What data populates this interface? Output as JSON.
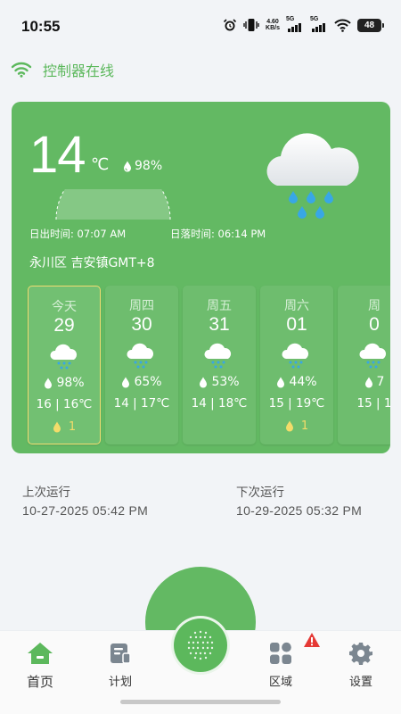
{
  "status_bar": {
    "time": "10:55",
    "net_speed": "4.60",
    "net_unit": "KB/s",
    "net_5g_1": "5G",
    "net_5g_2": "5G",
    "battery": "48"
  },
  "controller": {
    "status_text": "控制器在线",
    "color": "#5cb85c"
  },
  "weather": {
    "temperature": "14",
    "unit": "℃",
    "humidity": "98%",
    "sunrise_label": "日出时间:",
    "sunrise_time": "07:07 AM",
    "sunset_label": "日落时间:",
    "sunset_time": "06:14 PM",
    "location": "永川区 吉安镇GMT+8",
    "current_icon": "rain-cloud-icon",
    "card_color": "#63b963"
  },
  "forecast": [
    {
      "day": "今天",
      "date": "29",
      "humidity": "98%",
      "range": "16 | 16℃",
      "rain": "1",
      "icon": "rain-cloud-icon",
      "selected": true
    },
    {
      "day": "周四",
      "date": "30",
      "humidity": "65%",
      "range": "14 | 17℃",
      "rain": "",
      "icon": "rain-cloud-icon"
    },
    {
      "day": "周五",
      "date": "31",
      "humidity": "53%",
      "range": "14 | 18℃",
      "rain": "",
      "icon": "rain-cloud-icon"
    },
    {
      "day": "周六",
      "date": "01",
      "humidity": "44%",
      "range": "15 | 19℃",
      "rain": "1",
      "icon": "rain-cloud-icon"
    },
    {
      "day": "周",
      "date": "0",
      "humidity": "7",
      "range": "15 | 1",
      "rain": "",
      "icon": "rain-cloud-icon"
    }
  ],
  "schedule": {
    "last_label": "上次运行",
    "last_time": "10-27-2025 05:42 PM",
    "next_label": "下次运行",
    "next_time": "10-29-2025 05:32 PM"
  },
  "nav": {
    "home": "首页",
    "plan": "计划",
    "area": "区域",
    "settings": "设置",
    "accent": "#5cb85c",
    "alert_color": "#e53935"
  }
}
